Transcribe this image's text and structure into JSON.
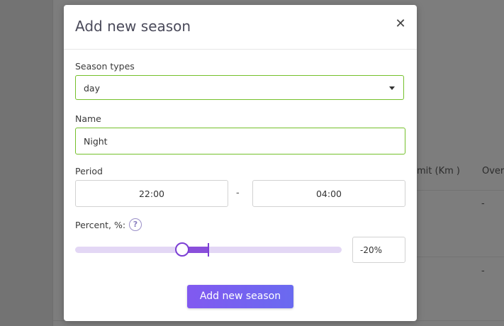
{
  "background": {
    "columns": [
      "mit (Km )",
      "Over"
    ],
    "cells": [
      "-",
      "-",
      "-",
      "-"
    ]
  },
  "modal": {
    "title": "Add new season",
    "close_icon": "close-icon",
    "season_types": {
      "label": "Season types",
      "value": "day"
    },
    "name": {
      "label": "Name",
      "value": "Night"
    },
    "period": {
      "label": "Period",
      "start": "22:00",
      "separator": "-",
      "end": "04:00"
    },
    "percent": {
      "label": "Percent, %:",
      "help_glyph": "?",
      "help_icon": "question-circle-icon",
      "value": "-20%",
      "slider_level": -20
    },
    "submit_label": "Add new season"
  },
  "colors": {
    "accent": "#7c3fd4",
    "valid_border": "#74c02a",
    "button_gradient_start": "#8159f0",
    "button_gradient_end": "#6a6af0"
  }
}
